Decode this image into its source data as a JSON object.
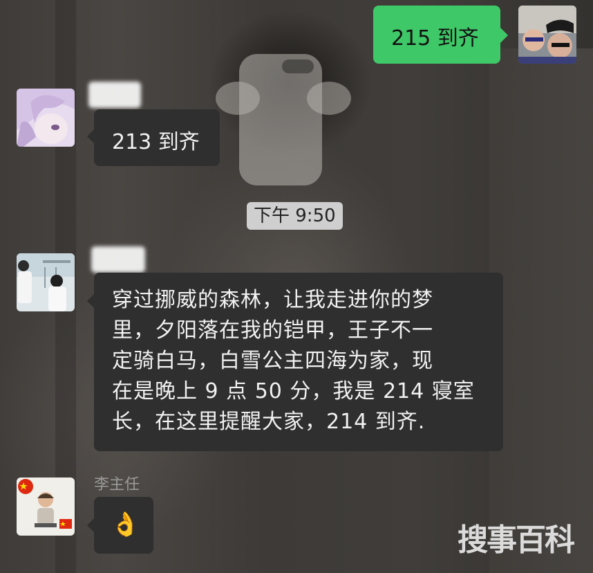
{
  "messages": [
    {
      "id": "m1",
      "side": "outgoing",
      "text": "215 到齐",
      "avatar": "group-selfie-avatar"
    },
    {
      "id": "m2",
      "side": "incoming",
      "text": "213 到齐",
      "avatar": "anime-girl-avatar"
    },
    {
      "id": "m3",
      "side": "incoming",
      "text": "穿过挪威的森林，让我走进你的梦里，夕阳落在我的铠甲，王子不一定骑白马，白雪公主四海为家，现在是晚上 9 点 50 分，我是 214 寝室长，在这里提醒大家，214 到齐.",
      "text_lines": [
        "穿过挪威的森林，让我走进你的梦",
        "里，夕阳落在我的铠甲，王子不一",
        "定骑白马，白雪公主四海为家，现",
        "在是晚上 9 点 50 分，我是 214 寝室",
        "长，在这里提醒大家，214 到齐."
      ],
      "avatar": "couple-photo-avatar"
    },
    {
      "id": "m4",
      "side": "incoming",
      "sender": "李主任",
      "text": "👌",
      "avatar": "kid-flag-avatar"
    }
  ],
  "timestamp": "下午 9:50",
  "watermark": "搜事百科",
  "colors": {
    "outgoing_bubble": "#3fc868",
    "incoming_bubble": "#2f2f2f",
    "timestamp_bg": "#cfcfcf"
  }
}
